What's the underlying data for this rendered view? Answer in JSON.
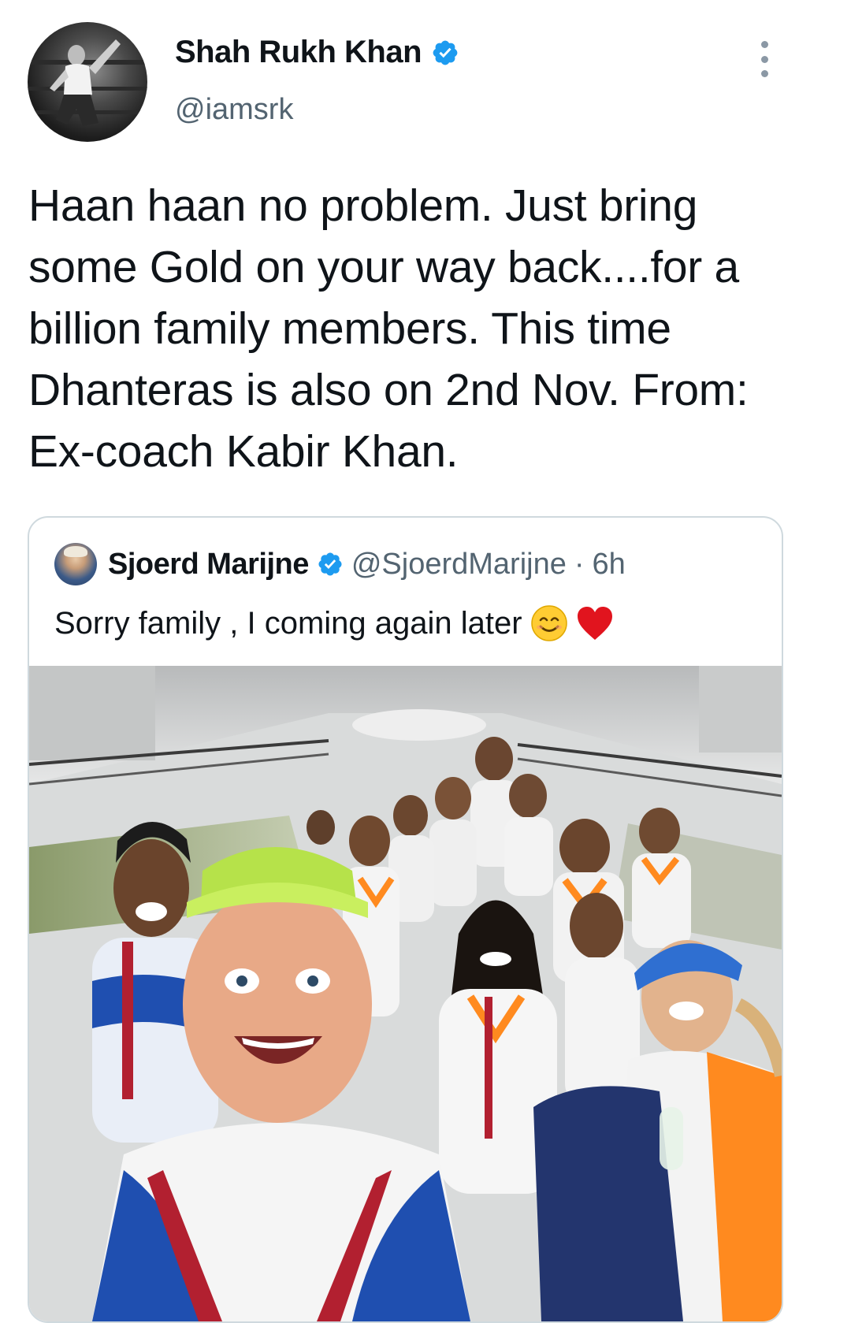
{
  "tweet": {
    "display_name": "Shah Rukh Khan",
    "handle": "@iamsrk",
    "text": "Haan haan no problem. Just bring some Gold on your way back....for a billion family members. This time Dhanteras is also on 2nd Nov. From: Ex-coach Kabir Khan.",
    "verified_icon": "verified-badge-icon",
    "more_icon": "more-vertical-icon",
    "colors": {
      "verified": "#1d9bf0",
      "secondary_text": "#536471",
      "border": "#cfd9de"
    }
  },
  "quoted_tweet": {
    "display_name": "Sjoerd Marijne",
    "handle": "@SjoerdMarijne",
    "separator": "·",
    "time": "6h",
    "text": "Sorry family , I coming again later",
    "emojis": [
      "smiling-face-icon",
      "red-heart-icon"
    ],
    "photo_icon": "team-selfie-photo"
  }
}
